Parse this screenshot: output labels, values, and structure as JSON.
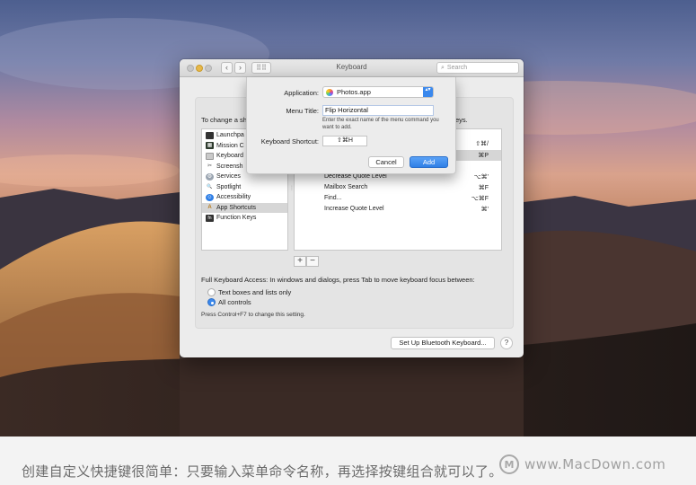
{
  "window": {
    "title": "Keyboard",
    "search_placeholder": "Search",
    "nav_back": "‹",
    "nav_forward": "›",
    "grid_glyph": "⠿⠿"
  },
  "panel": {
    "heading_left": "To change a sh",
    "heading_right": "eys."
  },
  "categories": [
    {
      "label": "Launchpa",
      "icon": "launchpad-icon",
      "color": "#333333",
      "glyph": ""
    },
    {
      "label": "Mission C",
      "icon": "mission-control-icon",
      "color": "#2e3b2e",
      "glyph": "▦"
    },
    {
      "label": "Keyboard",
      "icon": "keyboard-icon",
      "color": "#c9c9c9",
      "glyph": ""
    },
    {
      "label": "Screensh",
      "icon": "screenshot-icon",
      "color": "#ffffff",
      "glyph": "✂"
    },
    {
      "label": "Services",
      "icon": "services-gear-icon",
      "color": "#9aa4b0",
      "glyph": "⚙"
    },
    {
      "label": "Spotlight",
      "icon": "spotlight-icon",
      "color": "#ffffff",
      "glyph": "🔍"
    },
    {
      "label": "Accessibility",
      "icon": "accessibility-icon",
      "color": "#2f7fe6",
      "glyph": "☺"
    },
    {
      "label": "App Shortcuts",
      "icon": "app-shortcuts-icon",
      "color": "#e0a93a",
      "glyph": "A"
    },
    {
      "label": "Function Keys",
      "icon": "function-keys-icon",
      "color": "#333333",
      "glyph": "fn"
    }
  ],
  "shortcuts": [
    {
      "name": "",
      "key": "⇧⌘/"
    },
    {
      "name": "",
      "key": "⌘P"
    },
    {
      "name": "Decrease Quote Level",
      "key": "⌥⌘'"
    },
    {
      "name": "Mailbox Search",
      "key": "⌘F"
    },
    {
      "name": "Find...",
      "key": "⌥⌘F"
    },
    {
      "name": "Increase Quote Level",
      "key": "⌘'"
    }
  ],
  "table_controls": {
    "plus": "+",
    "minus": "−"
  },
  "keyboard_access": {
    "label": "Full Keyboard Access: In windows and dialogs, press Tab to move keyboard focus between:",
    "options": [
      "Text boxes and lists only",
      "All controls"
    ],
    "selected_index": 1,
    "note": "Press Control+F7 to change this setting."
  },
  "bottom": {
    "bluetooth_button": "Set Up Bluetooth Keyboard...",
    "help_button": "?"
  },
  "sheet": {
    "application_label": "Application:",
    "application_value": "Photos.app",
    "select_arrows": "▴▾",
    "menu_title_label": "Menu Title:",
    "menu_title_value": "Flip Horizontal",
    "hint": "Enter the exact name of the menu command you want to add.",
    "shortcut_label": "Keyboard Shortcut:",
    "shortcut_value": "⇧⌘H",
    "cancel": "Cancel",
    "add": "Add"
  },
  "caption": {
    "text": "创建自定义快捷键很简单：只要输入菜单命令名称，再选择按键组合就可以了。",
    "logo_glyph": "M",
    "watermark": "www.MacDown.com"
  }
}
